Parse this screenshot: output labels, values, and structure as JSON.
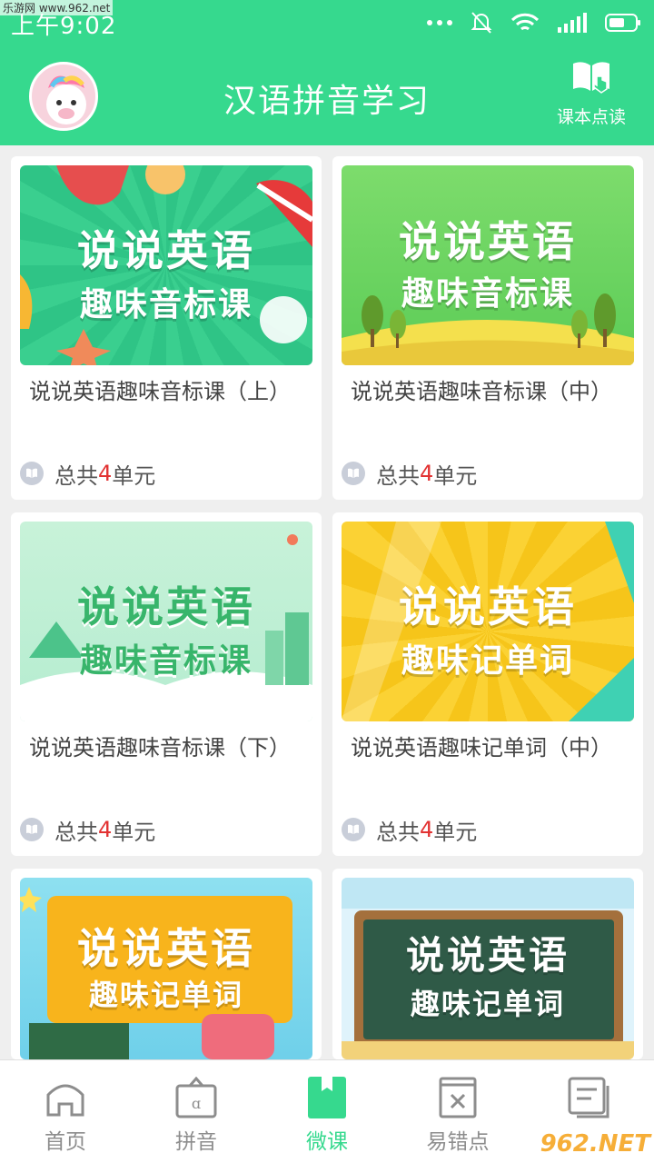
{
  "status": {
    "time": "上午9:02"
  },
  "header": {
    "title": "汉语拼音学习",
    "reader_label": "课本点读"
  },
  "courses": [
    {
      "art_line1": "说说英语",
      "art_line2": "趣味音标课",
      "name": "说说英语趣味音标课（上）",
      "units_prefix": "总共",
      "units_count": "4",
      "units_suffix": "单元"
    },
    {
      "art_line1": "说说英语",
      "art_line2": "趣味音标课",
      "name": "说说英语趣味音标课（中）",
      "units_prefix": "总共",
      "units_count": "4",
      "units_suffix": "单元"
    },
    {
      "art_line1": "说说英语",
      "art_line2": "趣味音标课",
      "name": "说说英语趣味音标课（下）",
      "units_prefix": "总共",
      "units_count": "4",
      "units_suffix": "单元"
    },
    {
      "art_line1": "说说英语",
      "art_line2": "趣味记单词",
      "name": "说说英语趣味记单词（中）",
      "units_prefix": "总共",
      "units_count": "4",
      "units_suffix": "单元"
    },
    {
      "art_line1": "说说英语",
      "art_line2": "趣味记单词"
    },
    {
      "art_line1": "说说英语",
      "art_line2": "趣味记单词"
    }
  ],
  "tabs": [
    {
      "label": "首页",
      "icon": "home-icon"
    },
    {
      "label": "拼音",
      "icon": "pinyin-icon"
    },
    {
      "label": "微课",
      "icon": "bookmark-icon"
    },
    {
      "label": "易错点",
      "icon": "mistake-icon"
    },
    {
      "label": "",
      "icon": "notes-icon"
    }
  ],
  "colors": {
    "primary": "#36d98e",
    "accent_count": "#e23232"
  },
  "watermark": {
    "site": "962.NET",
    "top_text": "乐游网 www.962.net"
  }
}
